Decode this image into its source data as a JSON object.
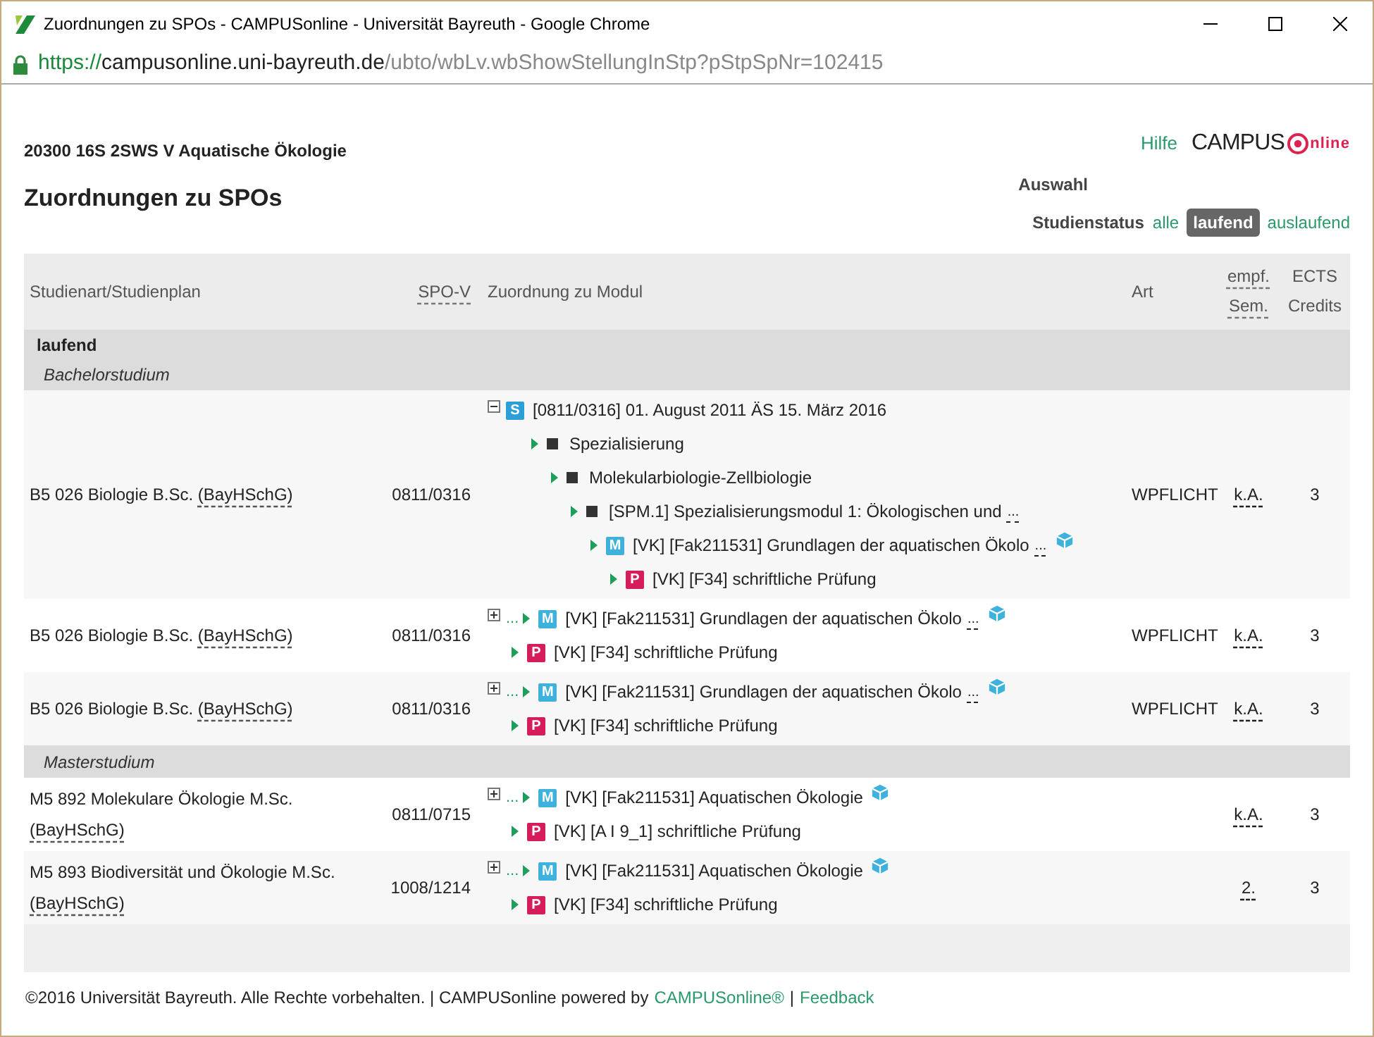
{
  "window": {
    "title": "Zuordnungen zu SPOs - CAMPUSonline - Universität Bayreuth - Google Chrome"
  },
  "address_bar": {
    "scheme": "https://",
    "host": "campusonline.uni-bayreuth.de",
    "path": "/ubto/wbLv.wbShowStellungInStp?pStpSpNr=102415"
  },
  "page": {
    "course": "20300 16S 2SWS V Aquatische Ökologie",
    "heading": "Zuordnungen zu SPOs",
    "help_link": "Hilfe",
    "logo": {
      "left": "CAMPUS",
      "right": "nline"
    },
    "filter": {
      "title": "Auswahl",
      "label": "Studienstatus",
      "options": [
        {
          "label": "alle",
          "selected": false
        },
        {
          "label": "laufend",
          "selected": true
        },
        {
          "label": "auslaufend",
          "selected": false
        }
      ]
    }
  },
  "table": {
    "columns": [
      {
        "label": "Studienart/Studienplan",
        "abbr": false
      },
      {
        "label": "SPO-V",
        "abbr": true
      },
      {
        "label": "Zuordnung zu Modul",
        "abbr": false
      },
      {
        "label": "Art",
        "abbr": false
      },
      {
        "label": "empf. Sem.",
        "abbr": true
      },
      {
        "label": "ECTS Credits",
        "abbr": false
      }
    ],
    "status_group": "laufend",
    "groups": [
      {
        "title": "Bachelorstudium",
        "rows": [
          {
            "plan": "B5 026 Biologie B.Sc.",
            "plan_abbr": "(BayHSchG)",
            "spo": "0811/0316",
            "art": "WPFLICHT",
            "sem": "k.A.",
            "ects": "3",
            "tree": [
              {
                "kind": "badge",
                "badge": "S",
                "expanded": true,
                "label": "[0811/0316] 01. August 2011 ÄS 15. März 2016",
                "children": [
                  {
                    "kind": "node",
                    "label": "Spezialisierung",
                    "children": [
                      {
                        "kind": "node",
                        "label": "Molekularbiologie-Zellbiologie",
                        "children": [
                          {
                            "kind": "node",
                            "label": "[SPM.1] Spezialisierungsmodul 1: Ökologischen und",
                            "more": "...",
                            "children": [
                              {
                                "kind": "badge",
                                "badge": "M",
                                "label": "[VK] [Fak211531] Grundlagen der aquatischen Ökolo",
                                "more": "...",
                                "cube": true,
                                "children": [
                                  {
                                    "kind": "badge",
                                    "badge": "P",
                                    "label": "[VK] [F34] schriftliche Prüfung"
                                  }
                                ]
                              }
                            ]
                          }
                        ]
                      }
                    ]
                  }
                ]
              }
            ]
          },
          {
            "plan": "B5 026 Biologie B.Sc.",
            "plan_abbr": "(BayHSchG)",
            "spo": "0811/0316",
            "art": "WPFLICHT",
            "sem": "k.A.",
            "ects": "3",
            "tree": [
              {
                "kind": "badge",
                "badge": "M",
                "expanded": false,
                "prefix": "...",
                "label": "[VK] [Fak211531] Grundlagen der aquatischen Ökolo",
                "more": "...",
                "cube": true
              },
              {
                "kind": "badge",
                "badge": "P",
                "label": "[VK] [F34] schriftliche Prüfung"
              }
            ]
          },
          {
            "plan": "B5 026 Biologie B.Sc.",
            "plan_abbr": "(BayHSchG)",
            "spo": "0811/0316",
            "art": "WPFLICHT",
            "sem": "k.A.",
            "ects": "3",
            "tree": [
              {
                "kind": "badge",
                "badge": "M",
                "expanded": false,
                "prefix": "...",
                "label": "[VK] [Fak211531] Grundlagen der aquatischen Ökolo",
                "more": "...",
                "cube": true
              },
              {
                "kind": "badge",
                "badge": "P",
                "label": "[VK] [F34] schriftliche Prüfung"
              }
            ]
          }
        ]
      },
      {
        "title": "Masterstudium",
        "rows": [
          {
            "plan": "M5 892 Molekulare Ökologie M.Sc.",
            "plan_abbr": "(BayHSchG)",
            "spo": "0811/0715",
            "sem": "k.A.",
            "ects": "3",
            "tree": [
              {
                "kind": "badge",
                "badge": "M",
                "expanded": false,
                "prefix": "...",
                "label": "[VK] [Fak211531] Aquatischen Ökologie",
                "cube": true
              },
              {
                "kind": "badge",
                "badge": "P",
                "label": "[VK] [A I 9_1] schriftliche Prüfung"
              }
            ]
          },
          {
            "plan": "M5 893 Biodiversität und Ökologie M.Sc.",
            "plan_abbr": "(BayHSchG)",
            "spo": "1008/1214",
            "sem": "2.",
            "ects": "3",
            "tree": [
              {
                "kind": "badge",
                "badge": "M",
                "expanded": false,
                "prefix": "...",
                "label": "[VK] [Fak211531] Aquatischen Ökologie",
                "cube": true
              },
              {
                "kind": "badge",
                "badge": "P",
                "label": "[VK] [F34] schriftliche Prüfung"
              }
            ]
          }
        ]
      }
    ]
  },
  "footer": {
    "text": "©2016 Universität Bayreuth. Alle Rechte vorbehalten. | CAMPUSonline powered by",
    "product_link": "CAMPUSonline®",
    "separator": "|",
    "feedback_link": "Feedback"
  }
}
